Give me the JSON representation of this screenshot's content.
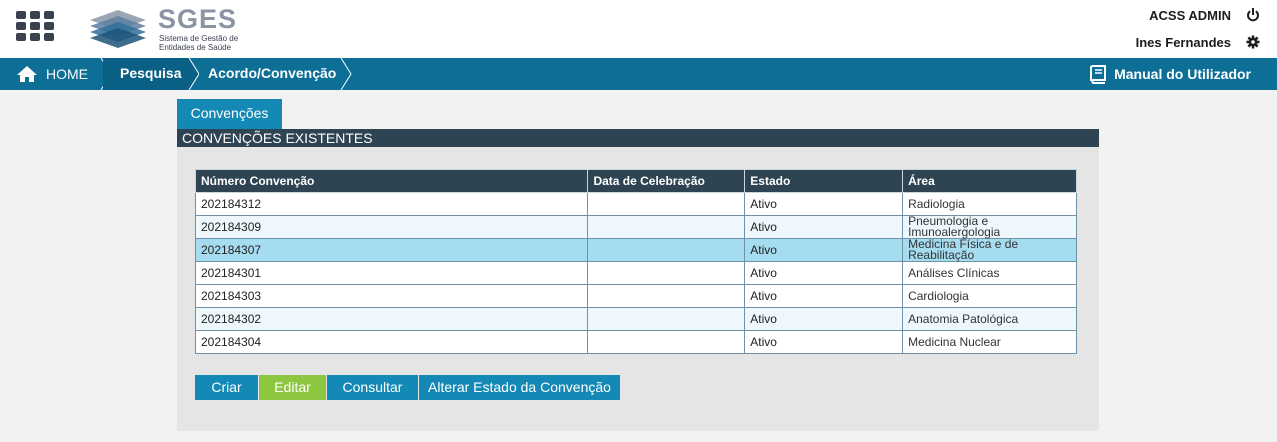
{
  "header": {
    "app_name": "SGES",
    "app_subtitle": "Sistema de Gestão de Entidades de Saúde",
    "user_role": "ACSS ADMIN",
    "user_name": "Ines Fernandes"
  },
  "breadcrumb": {
    "items": [
      {
        "label": "HOME"
      },
      {
        "label": "Pesquisa"
      },
      {
        "label": "Acordo/Convenção"
      }
    ],
    "manual_label": "Manual do Utilizador"
  },
  "tabs": [
    {
      "label": "Convenções",
      "active": true
    }
  ],
  "section_title": "CONVENÇÕES EXISTENTES",
  "table": {
    "columns": [
      "Número Convenção",
      "Data de Celebração",
      "Estado",
      "Área"
    ],
    "rows": [
      {
        "numero": "202184312",
        "data": "",
        "estado": "Ativo",
        "area": "Radiologia"
      },
      {
        "numero": "202184309",
        "data": "",
        "estado": "Ativo",
        "area": "Pneumologia e Imunoalergologia"
      },
      {
        "numero": "202184307",
        "data": "",
        "estado": "Ativo",
        "area": "Medicina Física e de Reabilitação",
        "selected": true
      },
      {
        "numero": "202184301",
        "data": "",
        "estado": "Ativo",
        "area": "Análises Clínicas"
      },
      {
        "numero": "202184303",
        "data": "",
        "estado": "Ativo",
        "area": "Cardiologia"
      },
      {
        "numero": "202184302",
        "data": "",
        "estado": "Ativo",
        "area": "Anatomia Patológica"
      },
      {
        "numero": "202184304",
        "data": "",
        "estado": "Ativo",
        "area": "Medicina Nuclear"
      }
    ]
  },
  "actions": {
    "criar": "Criar",
    "editar": "Editar",
    "consultar": "Consultar",
    "alterar_estado": "Alterar Estado da Convenção"
  },
  "colors": {
    "nav_bar": "#0d6e96",
    "table_header": "#2e4453",
    "button_blue": "#1589b6",
    "button_green": "#8dc63f",
    "selected_row": "#a6dcf0"
  }
}
